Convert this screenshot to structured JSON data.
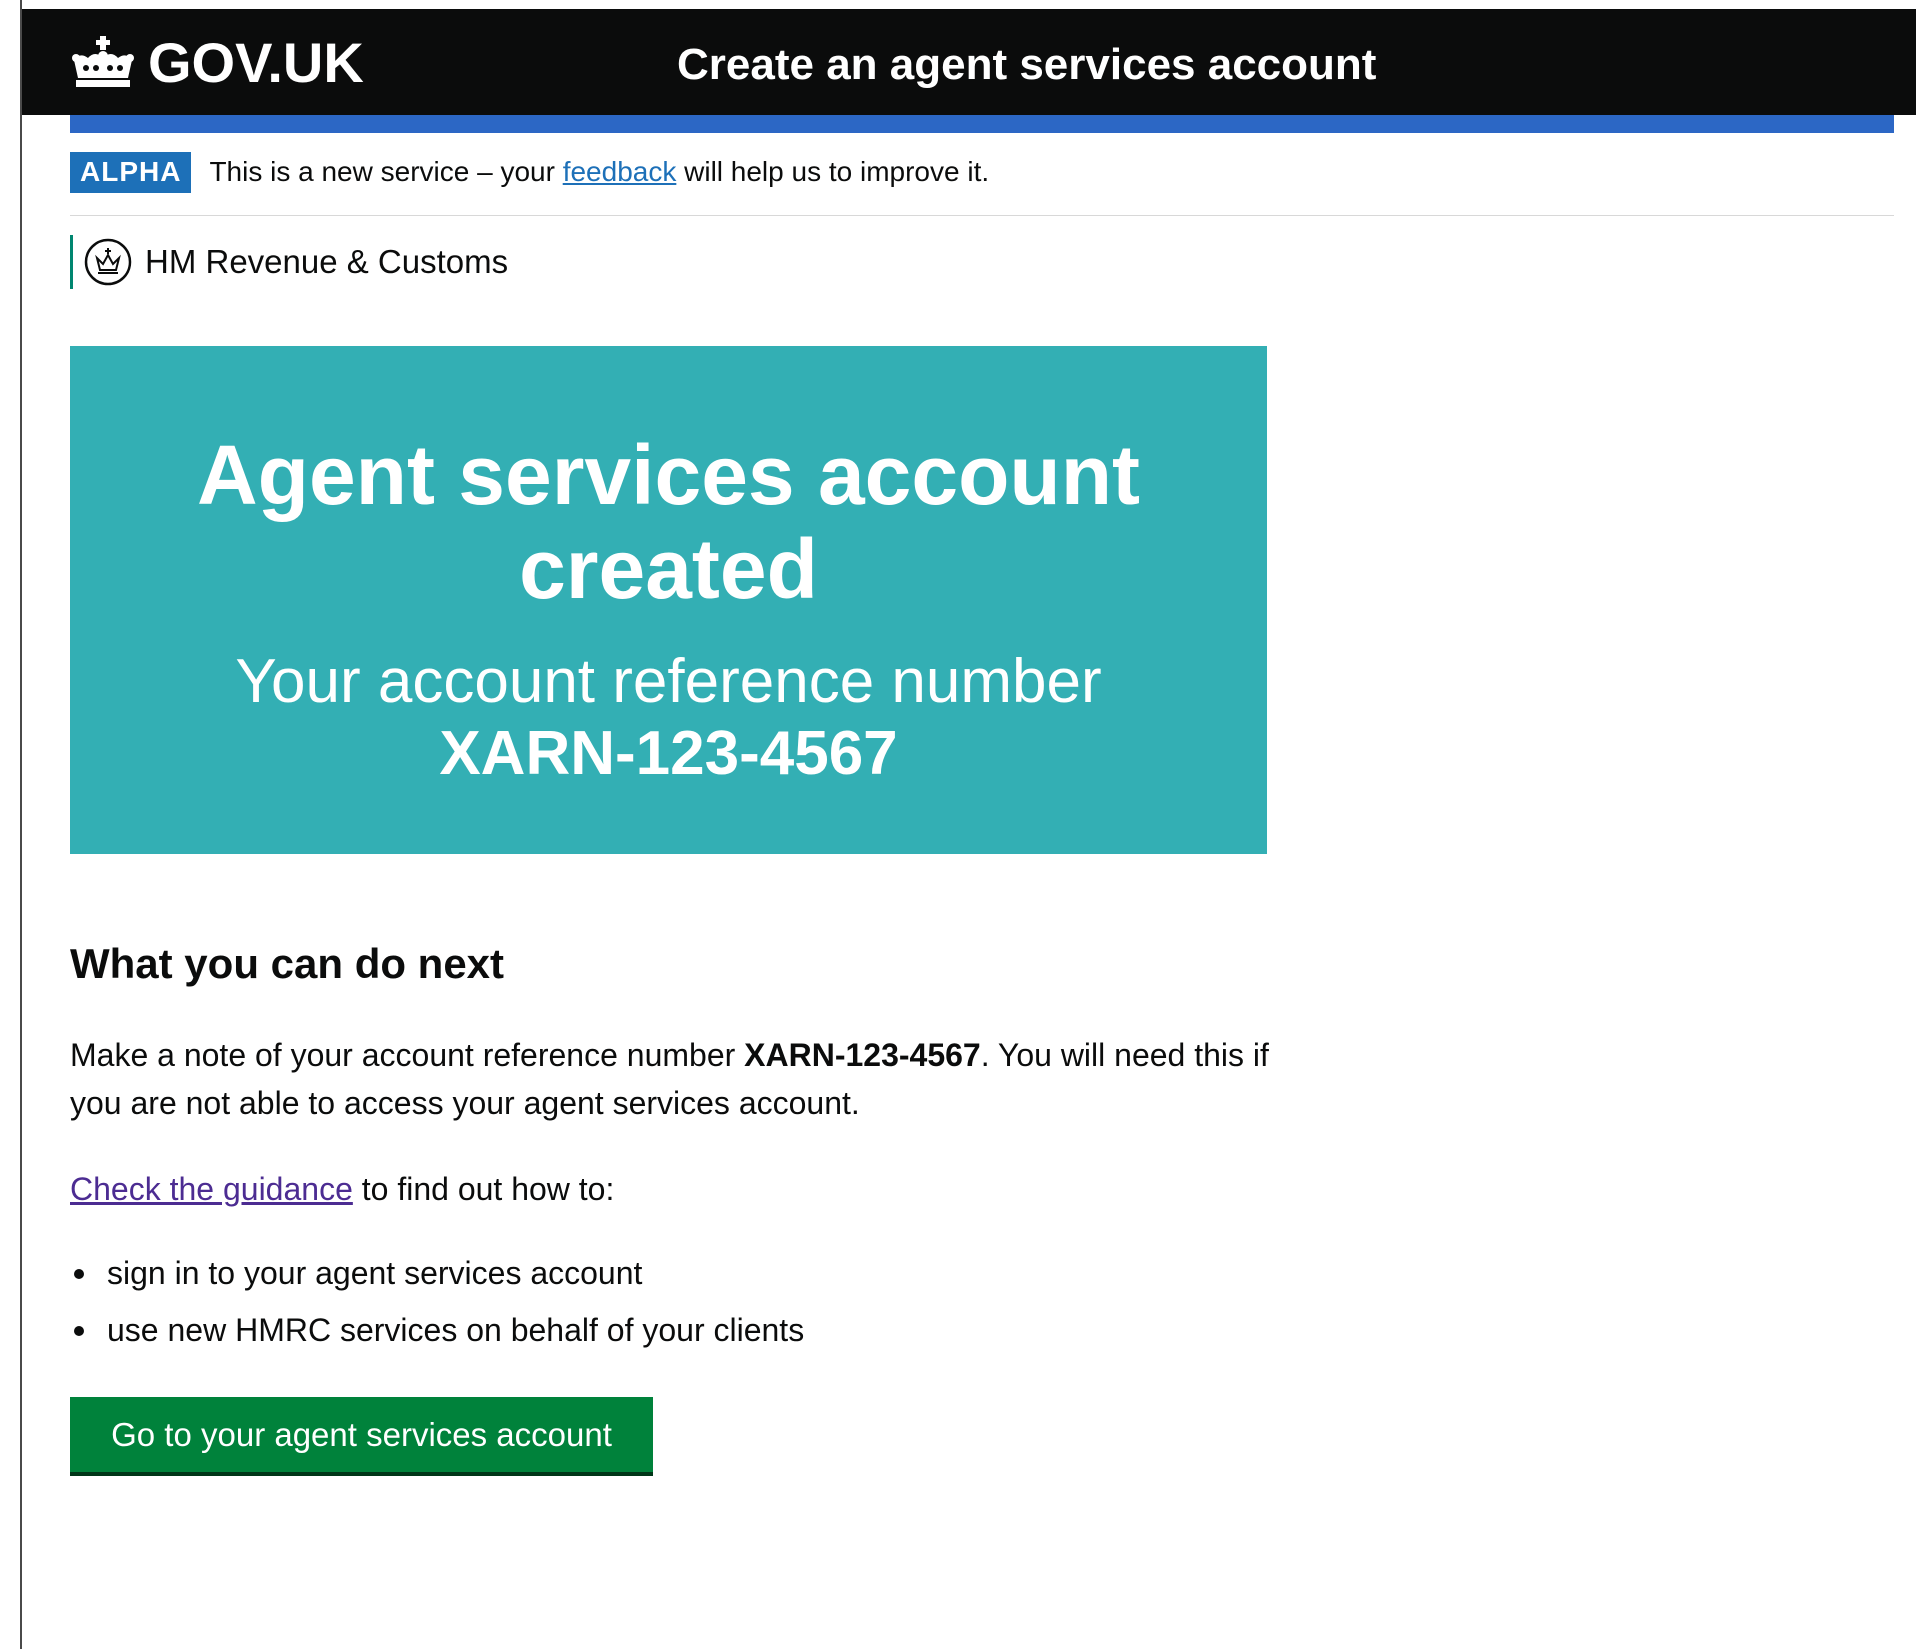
{
  "header": {
    "logo_text": "GOV.UK",
    "service_name": "Create an agent services account",
    "logo_icon": "crown-icon"
  },
  "phase_banner": {
    "tag": "ALPHA",
    "text_before": "This is a new service – your ",
    "link_text": "feedback",
    "text_after": " will help us to improve it."
  },
  "department": {
    "icon": "hmrc-crest-icon",
    "name": "HM Revenue & Customs"
  },
  "confirmation_panel": {
    "title": "Agent services account created",
    "body_label": "Your account reference number",
    "reference": "XARN-123-4567"
  },
  "next_steps": {
    "heading": "What you can do next",
    "para1_before": "Make a note of your account reference number ",
    "para1_reference": "XARN-123-4567",
    "para1_after": ". You will need this if you are not able to access your agent services account.",
    "guidance_link": "Check the guidance",
    "guidance_after": " to find out how to:",
    "bullets": [
      "sign in to your agent services account",
      "use new HMRC services on behalf of your clients"
    ],
    "button_label": "Go to your agent services account"
  },
  "colors": {
    "header_bg": "#0b0c0c",
    "blue_bar": "#2c67c5",
    "phase_tag": "#1d70b8",
    "panel_bg": "#33afb4",
    "button_bg": "#00823b",
    "link": "#1d70b8",
    "visited_link": "#4c2c92",
    "hmrc_brand": "#008670"
  }
}
